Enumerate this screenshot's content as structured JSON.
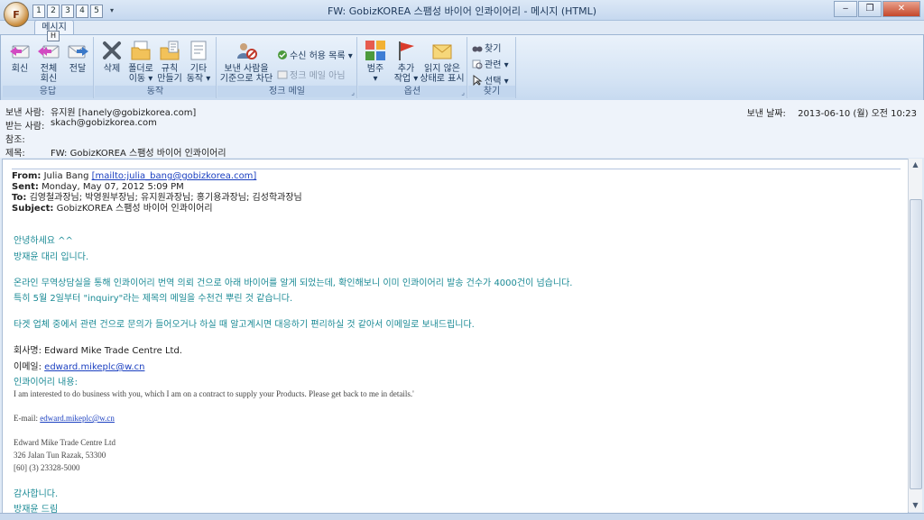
{
  "window": {
    "title": "FW: GobizKOREA 스팸성 바이어 인콰이어리 - 메시지 (HTML)",
    "app_icon_letter": "F",
    "qat_keys": [
      "1",
      "2",
      "3",
      "4",
      "5"
    ],
    "min_label": "‒",
    "max_label": "❐",
    "close_label": "✕"
  },
  "ribbon": {
    "active_tab": "메시지",
    "keytip": "H",
    "help_label": "?",
    "groups": {
      "respond": {
        "label": "응답",
        "reply": "회신",
        "reply_all_1": "전체",
        "reply_all_2": "회신",
        "forward": "전달"
      },
      "actions": {
        "label": "동작",
        "delete": "삭제",
        "move_1": "폴더로",
        "move_2": "이동 ▾",
        "rules_1": "규칙",
        "rules_2": "만들기",
        "other_1": "기타",
        "other_2": "동작 ▾"
      },
      "junk": {
        "label": "정크 메일",
        "block_1": "보낸 사람을",
        "block_2": "기준으로 차단",
        "safe_list": "수신 허용 목록 ▾",
        "not_junk": "정크 메일 아님"
      },
      "options": {
        "label": "옵션",
        "categorize_1": "범주",
        "categorize_2": "▾",
        "followup_1": "추가",
        "followup_2": "작업 ▾",
        "unread_1": "읽지 않은",
        "unread_2": "상태로 표시"
      },
      "find": {
        "label": "찾기",
        "find": "찾기",
        "related": "관련 ▾",
        "select": "선택 ▾"
      }
    }
  },
  "header": {
    "from_label": "보낸 사람:",
    "from_value": "유지원 [hanely@gobizkorea.com]",
    "to_label": "받는 사람:",
    "to_value": "skach@gobizkorea.com",
    "cc_label": "참조:",
    "cc_value": "",
    "subject_label": "제목:",
    "subject_value": "FW: GobizKOREA 스팸성 바이어 인콰이어리",
    "sent_label": "보낸 날짜:",
    "sent_value": "2013-06-10 (월) 오전 10:23"
  },
  "body": {
    "fwd": {
      "from_label": "From:",
      "from_name": "Julia Bang",
      "from_link": "[mailto:julia_bang@gobizkorea.com]",
      "sent_label": "Sent:",
      "sent_value": "Monday, May 07, 2012 5:09 PM",
      "to_label": "To:",
      "to_value": "김영철과장님; 박영원부장님; 유지원과장님; 홍기용과장님; 김성학과장님",
      "subject_label": "Subject:",
      "subject_value": "GobizKOREA 스팸성 바이어 인콰이어리"
    },
    "greeting": "안녕하세요 ^^",
    "intro": "방재윤 대리 입니다.",
    "para1": "온라인 무역상담실을 통해 인콰이어리 번역 의뢰 건으로 아래 바이어를 알게 되었는데, 확인해보니 이미 인콰이어리 발송 건수가 4000건이 넘습니다.",
    "para2": "특히 5월 2일부터 \"inquiry\"라는 제목의 메일을 수천건 뿌린 것 같습니다.",
    "para3": "타겟 업체 중에서 관련 건으로 문의가 들어오거나 하실 때 알고계시면 대응하기 편리하실 것 같아서 이메일로 보내드립니다.",
    "company_label": "회사명:",
    "company_value": "Edward Mike Trade Centre Ltd.",
    "email_label": "이메일:",
    "email_value": "edward.mikeplc@w.cn",
    "inquiry_label": "인콰이어리 내용:",
    "inquiry_text": "I am interested to do business with you, which I am on a contract to supply your Products. Please get back to me in details.'",
    "inquiry_email_label": "E-mail:",
    "inquiry_email": "edward.mikeplc@w.cn",
    "sig1": "Edward Mike Trade Centre Ltd",
    "sig2": "326 Jalan Tun Razak, 53300",
    "sig3": "[60] (3) 23328-5000",
    "thanks": "감사합니다.",
    "closing": "방재윤 드림"
  }
}
